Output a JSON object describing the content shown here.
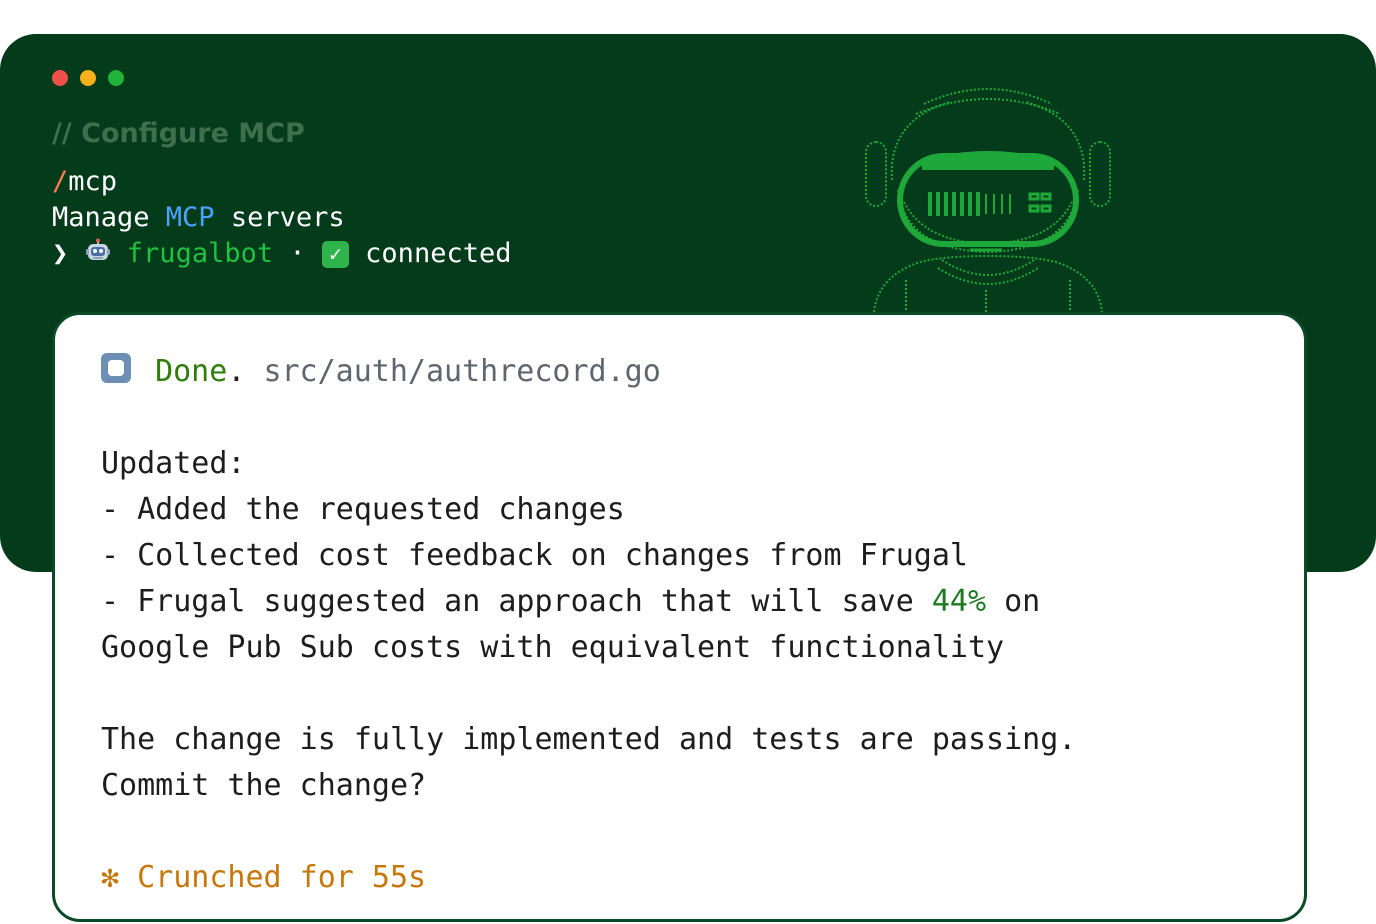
{
  "window": {
    "traffic_lights": [
      "#f0504a",
      "#f6b11d",
      "#1fb33a"
    ]
  },
  "terminal": {
    "comment": "// Configure MCP",
    "command_slash": "/",
    "command_name": "mcp",
    "desc_prefix": "Manage ",
    "desc_mcp": "MCP",
    "desc_suffix": " servers",
    "prompt_glyph": "❯",
    "robot_emoji": "robot-icon",
    "server_name": "frugalbot",
    "separator": "·",
    "status_icon": "checkmark-icon",
    "status_text": "connected"
  },
  "response": {
    "done_label": "Done",
    "done_punct": ".",
    "file_path": "src/auth/authrecord.go",
    "updated_heading": "Updated:",
    "bullets": [
      "- Added the requested changes",
      "- Collected cost feedback on changes from Frugal"
    ],
    "bullet3_prefix": "- Frugal suggested an approach that will save ",
    "bullet3_percent": "44%",
    "bullet3_suffix": " on",
    "bullet3_continued": "Google Pub Sub costs with equivalent functionality",
    "summary_line1": "The change is fully implemented and tests are passing.",
    "summary_line2": "Commit the change?",
    "status_glyph": "✻",
    "status_text": "Crunched for 55s"
  },
  "colors": {
    "terminal_bg": "#033b1b",
    "accent_green": "#20c140",
    "mcp_blue": "#4aa3ff",
    "slash_orange": "#ff7e50",
    "crunch_orange": "#c8770a",
    "done_green": "#2f7d0b"
  }
}
